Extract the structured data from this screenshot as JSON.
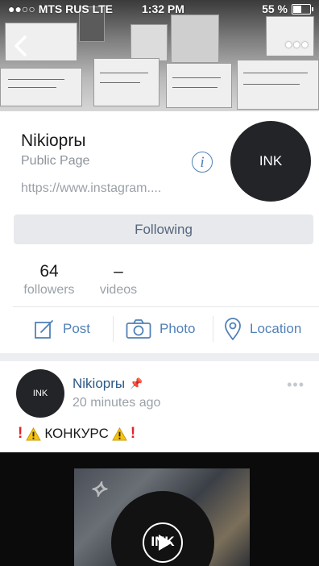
{
  "status_bar": {
    "carrier": "●●○○ MTS RUS  LTE",
    "time": "1:32 PM",
    "battery": "55 %"
  },
  "profile": {
    "name": "Nikioprы",
    "type": "Public Page",
    "url": "https://www.instagram....",
    "avatar_text": "INK",
    "follow_label": "Following"
  },
  "stats": {
    "followers_count": "64",
    "followers_label": "followers",
    "videos_count": "–",
    "videos_label": "videos"
  },
  "actions": {
    "post_label": "Post",
    "photo_label": "Photo",
    "location_label": "Location"
  },
  "post": {
    "author": "Nikioprы",
    "time": "20 minutes ago",
    "avatar_text": "INK",
    "text": "КОНКУРС",
    "video_overlay": "INK"
  },
  "icons": {
    "back": "chevron-left-icon",
    "more": "more-dots-icon",
    "info": "info-icon",
    "post": "edit-icon",
    "photo": "camera-icon",
    "location": "map-pin-icon",
    "pin": "pin-icon",
    "warning": "warning-icon",
    "play": "play-icon"
  },
  "colors": {
    "accent": "#5181b8",
    "link": "#2a5885",
    "muted": "#9aa1a8",
    "button_bg": "#e7e9ec",
    "avatar_bg": "#222428"
  }
}
